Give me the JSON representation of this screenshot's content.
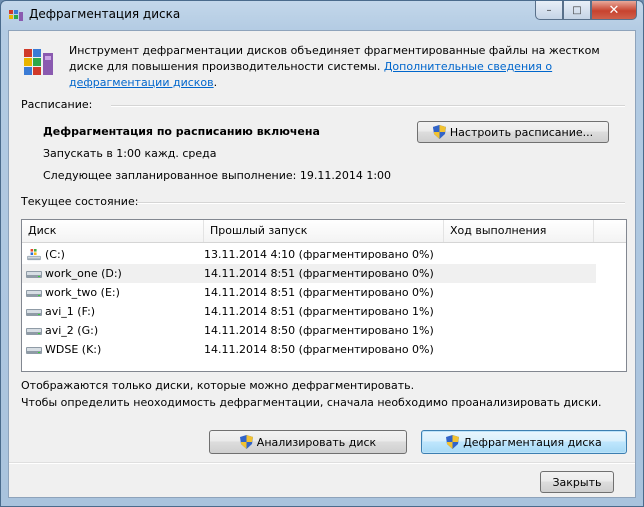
{
  "window": {
    "title": "Дефрагментация диска"
  },
  "caption": {
    "minimize": "–",
    "maximize": "□",
    "close": "✕"
  },
  "intro": {
    "text": "Инструмент дефрагментации дисков объединяет фрагментированные файлы на жестком диске для повышения производительности системы. ",
    "link": "Дополнительные сведения о дефрагментации дисков",
    "link_suffix": "."
  },
  "schedule": {
    "section_label": "Расписание:",
    "status": "Дефрагментация по расписанию включена",
    "run_at": "Запускать в 1:00 кажд. среда",
    "next_run": "Следующее запланированное выполнение: 19.11.2014 1:00",
    "configure_button": "Настроить расписание..."
  },
  "current": {
    "section_label": "Текущее состояние:",
    "columns": [
      "Диск",
      "Прошлый запуск",
      "Ход выполнения"
    ],
    "rows": [
      {
        "disk": "(C:)",
        "last_run": "13.11.2014 4:10 (фрагментировано 0%)",
        "progress": "",
        "icon": "windows-drive-icon"
      },
      {
        "disk": "work_one (D:)",
        "last_run": "14.11.2014 8:51 (фрагментировано 0%)",
        "progress": "",
        "icon": "hard-drive-icon"
      },
      {
        "disk": "work_two (E:)",
        "last_run": "14.11.2014 8:51 (фрагментировано 0%)",
        "progress": "",
        "icon": "hard-drive-icon"
      },
      {
        "disk": "avi_1 (F:)",
        "last_run": "14.11.2014 8:51 (фрагментировано 1%)",
        "progress": "",
        "icon": "hard-drive-icon"
      },
      {
        "disk": "avi_2 (G:)",
        "last_run": "14.11.2014 8:50 (фрагментировано 1%)",
        "progress": "",
        "icon": "hard-drive-icon"
      },
      {
        "disk": "WDSE (K:)",
        "last_run": "14.11.2014 8:50 (фрагментировано 0%)",
        "progress": "",
        "icon": "hard-drive-icon"
      }
    ]
  },
  "notes": {
    "line1": "Отображаются только диски, которые можно дефрагментировать.",
    "line2": "Чтобы определить неоходимость  дефрагментации, сначала необходимо проанализировать диски."
  },
  "buttons": {
    "analyze": "Анализировать диск",
    "defrag": "Дефрагментация диска",
    "close": "Закрыть"
  },
  "colors": {
    "link": "#0066cc",
    "selected_row": "#f0f0f0"
  }
}
